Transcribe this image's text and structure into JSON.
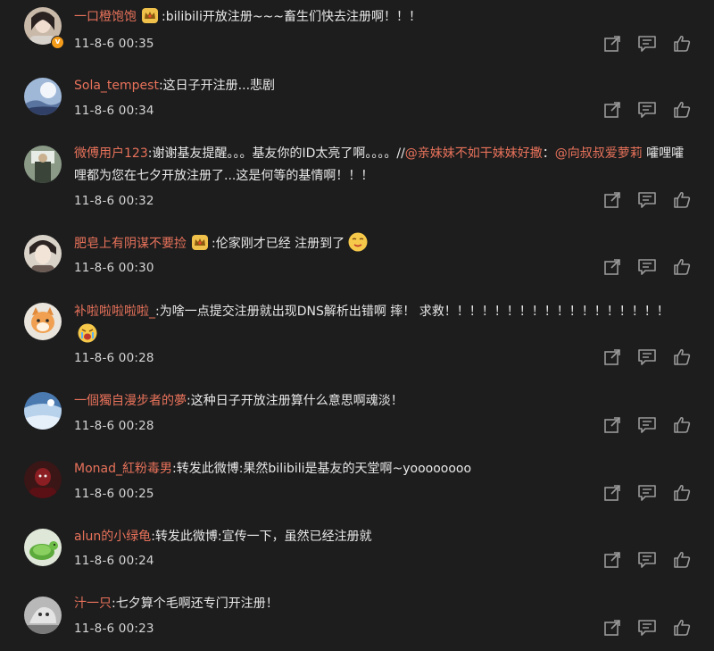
{
  "comments": [
    {
      "user": "一口橙饱饱",
      "has_crown": true,
      "verified": "v",
      "text": ":bilibili开放注册~~~畜生们快去注册啊！！！",
      "time": "11-8-6 00:35"
    },
    {
      "user": "Sola_tempest",
      "text": ":这日子开注册...悲剧",
      "time": "11-8-6 00:34"
    },
    {
      "user": "微傅用户123",
      "text": ":谢谢基友提醒。。。基友你的ID太亮了啊。。。。//",
      "mention1": "@亲妹妹不如干妹妹好撒",
      "sep": "：",
      "mention2": "@向叔叔爱萝莉",
      "text2": " 嚯哩嚯哩都为您在七夕开放注册了...这是何等的基情啊！！！",
      "time": "11-8-6 00:32"
    },
    {
      "user": "肥皂上有阴谋不要捡",
      "has_crown": true,
      "text": ":伦家刚才已经 注册到了",
      "emoji": "smug-face",
      "time": "11-8-6 00:30"
    },
    {
      "user": "补啦啦啦啦啦_",
      "text": ":为啥一点提交注册就出现DNS解析出错啊 摔！ 求救！！！！！！！！！！！！！！！！！！",
      "emoji": "crying-face",
      "time": "11-8-6 00:28"
    },
    {
      "user": "一個獨自漫步者的夢",
      "text": ":这种日子开放注册算什么意思啊魂淡！",
      "time": "11-8-6 00:28"
    },
    {
      "user": "Monad_紅粉毒男",
      "text": ":转发此微博:果然bilibili是基友的天堂啊~yoooooooo",
      "time": "11-8-6 00:25"
    },
    {
      "user": "alun的小绿龟",
      "text": ":转发此微博:宣传一下，虽然已经注册就",
      "time": "11-8-6 00:24"
    },
    {
      "user": "汁一只",
      "text": ":七夕算个毛啊还专门开注册！",
      "time": "11-8-6 00:23"
    }
  ],
  "icons": {
    "share": "share-icon",
    "comment": "comment-icon",
    "like": "thumbs-up-icon"
  },
  "colors": {
    "background": "#1d1d1e",
    "username": "#e8725a",
    "text": "#e8e8e8",
    "icon": "#9a9a9a"
  }
}
